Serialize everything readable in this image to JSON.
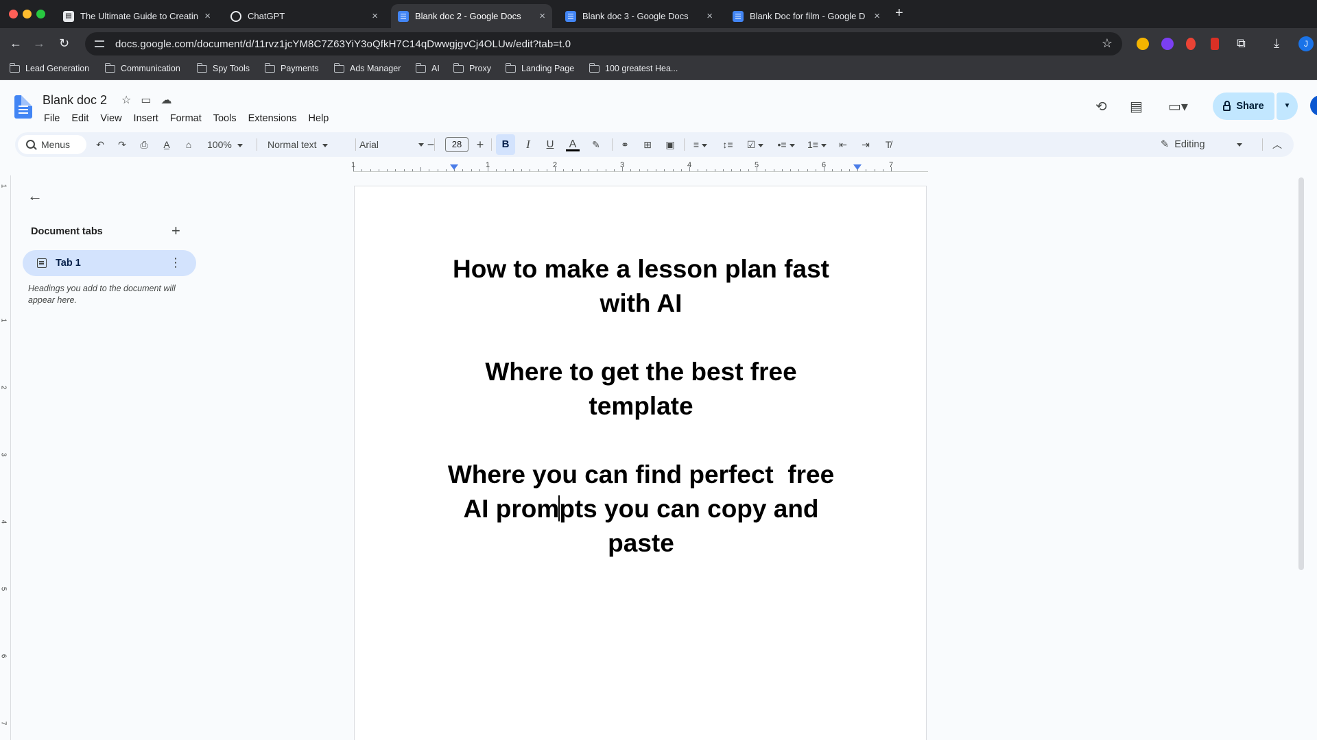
{
  "browser": {
    "tabs": [
      {
        "title": "The Ultimate Guide to Creatin",
        "icon": "generic-page-icon",
        "active": false
      },
      {
        "title": "ChatGPT",
        "icon": "chatgpt-icon",
        "active": false
      },
      {
        "title": "Blank doc 2 - Google Docs",
        "icon": "google-docs-icon",
        "active": true
      },
      {
        "title": "Blank doc 3 - Google Docs",
        "icon": "google-docs-icon",
        "active": false
      },
      {
        "title": "Blank Doc for film - Google D",
        "icon": "google-docs-icon",
        "active": false
      }
    ],
    "url": "docs.google.com/document/d/11rvz1jcYM8C7Z63YiY3oQfkH7C14qDwwgjgvCj4OLUw/edit?tab=t.0",
    "avatar_letter": "J",
    "bookmarks": [
      "Lead Generation",
      "Communication",
      "Spy Tools",
      "Payments",
      "Ads Manager",
      "AI",
      "Proxy",
      "Landing Page",
      "100 greatest Hea..."
    ]
  },
  "docs": {
    "title": "Blank doc 2",
    "menu": [
      "File",
      "Edit",
      "View",
      "Insert",
      "Format",
      "Tools",
      "Extensions",
      "Help"
    ],
    "share_label": "Share",
    "toolbar": {
      "search_label": "Menus",
      "zoom": "100%",
      "style": "Normal text",
      "font": "Arial",
      "font_size": "28",
      "bold_glyph": "B",
      "italic_glyph": "I",
      "underline_glyph": "U",
      "mode": "Editing"
    },
    "ruler_numbers": [
      "1",
      "1",
      "2",
      "3",
      "4",
      "5",
      "6",
      "7"
    ],
    "vruler_numbers": [
      "1",
      "1",
      "2",
      "3",
      "4",
      "5",
      "6",
      "7"
    ]
  },
  "outline": {
    "header": "Document tabs",
    "tab_name": "Tab 1",
    "hint": "Headings you add to the document will appear here."
  },
  "document": {
    "heading1_line1": "How to make a lesson plan fast",
    "heading1_line2": "with AI",
    "heading2_line1": "Where to get the best free",
    "heading2_line2": "template",
    "heading3_line1": "Where you can find perfect  free",
    "heading3_line2_before_cursor": "AI prom",
    "heading3_line2_after_cursor": "pts you can copy and",
    "heading3_line3": "paste"
  }
}
